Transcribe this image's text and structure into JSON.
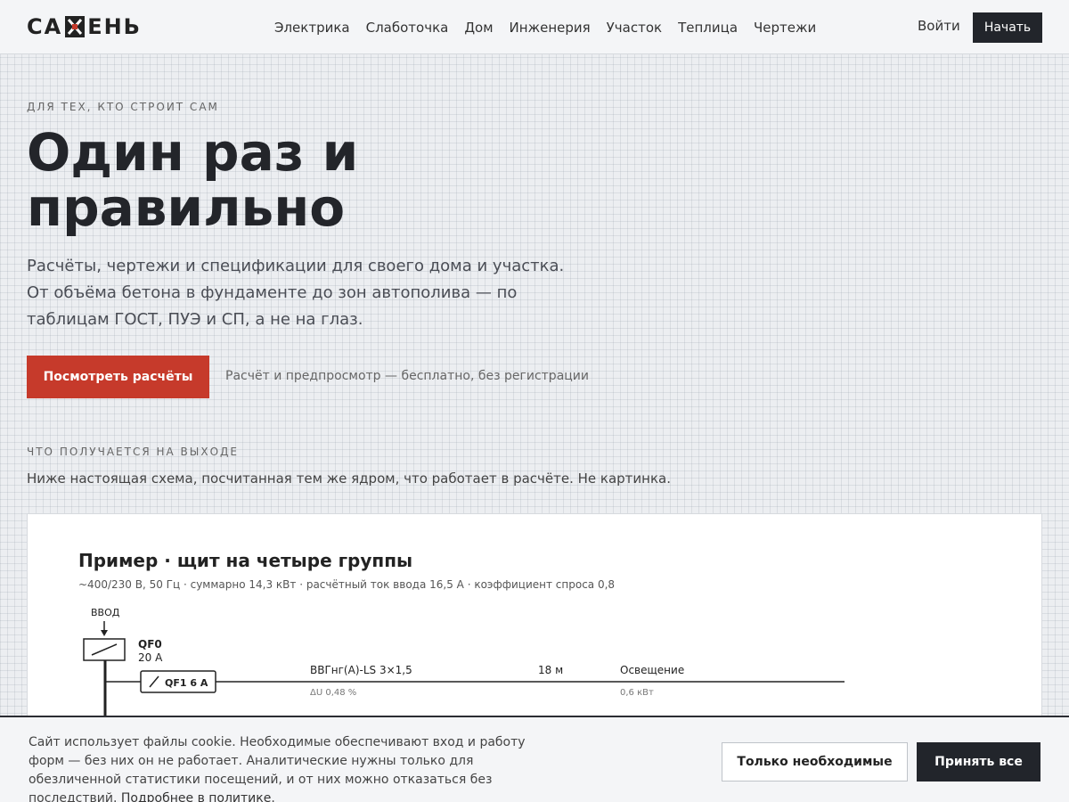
{
  "header": {
    "logo_left": "СА",
    "logo_right": "ЕНЬ",
    "nav": [
      "Электрика",
      "Слаботочка",
      "Дом",
      "Инженерия",
      "Участок",
      "Теплица",
      "Чертежи"
    ],
    "login_label": "Войти",
    "start_label": "Начать"
  },
  "hero": {
    "eyebrow": "ДЛЯ ТЕХ, КТО СТРОИТ САМ",
    "title_line1": "Один раз и",
    "title_line2": "правильно",
    "subtitle": "Расчёты, чертежи и спецификации для своего дома и участка. От объёма бетона в фундаменте до зон автополива — по таблицам ГОСТ, ПУЭ и СП, а не на глаз.",
    "cta_label": "Посмотреть расчёты",
    "cta_note": "Расчёт и предпросмотр — бесплатно, без регистрации"
  },
  "output_section": {
    "eyebrow": "ЧТО ПОЛУЧАЕТСЯ НА ВЫХОДЕ",
    "description": "Ниже настоящая схема, посчитанная тем же ядром, что работает в расчёте. Не картинка."
  },
  "example": {
    "title": "Пример · щит на четыре группы",
    "meta": "~400/230 В, 50 Гц · суммарно 14,3 кВт · расчётный ток ввода 16,5 А · коэффициент спроса 0,8",
    "input_label": "ВВОД",
    "main_breaker": "QF0",
    "main_rating": "20 А",
    "group": {
      "breaker": "QF1 6 А",
      "cable": "ВВГнг(А)-LS 3×1,5",
      "length": "18 м",
      "load": "Освещение",
      "drop": "ΔU 0,48 %",
      "power": "0,6 кВт"
    }
  },
  "cookie": {
    "text": "Сайт использует файлы cookie. Необходимые обеспечивают вход и работу форм — без них он не работает. Аналитические нужны только для обезличенной статистики посещений, и от них можно отказаться без последствий.",
    "link": "Подробнее в политике",
    "suffix": ".",
    "necessary_label": "Только необходимые",
    "accept_label": "Принять все"
  },
  "colors": {
    "accent": "#c63a2b",
    "dark": "#22252b",
    "background": "#eceef1"
  }
}
